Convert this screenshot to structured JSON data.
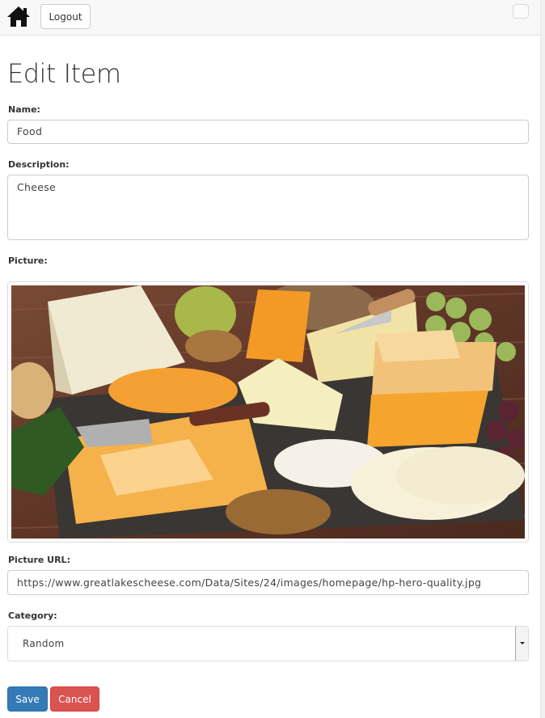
{
  "navbar": {
    "home_icon": "house-icon",
    "logout_label": "Logout",
    "toggle_icon": "menu-toggle-icon"
  },
  "page": {
    "title": "Edit Item"
  },
  "form": {
    "name_label": "Name:",
    "name_value": "Food",
    "description_label": "Description:",
    "description_value": "Cheese",
    "picture_label": "Picture:",
    "picture_alt": "cheese-platter-image",
    "picture_url_label": "Picture URL:",
    "picture_url_value": "https://www.greatlakescheese.com/Data/Sites/24/images/homepage/hp-hero-quality.jpg",
    "category_label": "Category:",
    "category_selected": "Random"
  },
  "actions": {
    "save_label": "Save",
    "cancel_label": "Cancel"
  },
  "colors": {
    "primary": "#337ab7",
    "danger": "#d9534f",
    "navbar_bg": "#f8f8f8"
  }
}
